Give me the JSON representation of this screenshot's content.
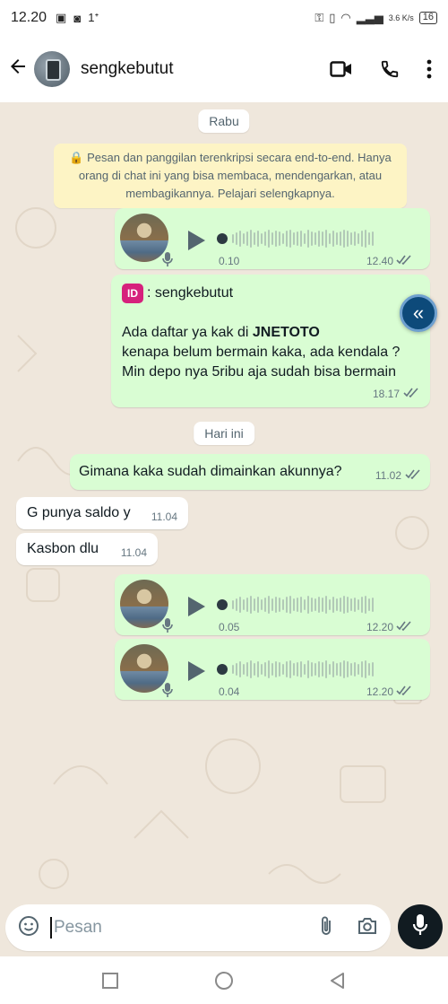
{
  "status_bar": {
    "time": "12.20",
    "notification_marks": "1ᐩ",
    "net_speed": "3.6 K/s",
    "battery": "16"
  },
  "header": {
    "contact_name": "sengkebutut"
  },
  "chat": {
    "date_1": "Rabu",
    "encryption_notice": "🔒 Pesan dan panggilan terenkripsi secara end-to-end. Hanya orang di chat ini yang bisa membaca, mendengarkan, atau membagikannya. Pelajari selengkapnya.",
    "voice_1": {
      "duration": "0.10",
      "time": "12.40"
    },
    "forward": {
      "badge": "ID",
      "sender": ": sengkebutut",
      "line1_prefix": "Ada daftar ya kak di ",
      "line1_bold": "JNETOTO",
      "line2": "kenapa belum bermain kaka, ada kendala ?",
      "line3": "Min depo nya 5ribu aja sudah bisa bermain",
      "time": "18.17"
    },
    "fab_icon": "double-chevron-left-icon",
    "date_2": "Hari ini",
    "msg_out_1": {
      "text": "Gimana kaka sudah dimainkan akunnya?",
      "time": "11.02"
    },
    "msg_in_1": {
      "text": "G punya saldo y",
      "time": "11.04"
    },
    "msg_in_2": {
      "text": "Kasbon dlu",
      "time": "11.04"
    },
    "voice_2": {
      "duration": "0.05",
      "time": "12.20"
    },
    "voice_3": {
      "duration": "0.04",
      "time": "12.20"
    }
  },
  "composer": {
    "placeholder": "Pesan"
  },
  "colors": {
    "out_bubble": "#d9fdd3",
    "in_bubble": "#ffffff",
    "read_ticks": "#667781",
    "wallpaper": "#efe7dc"
  }
}
